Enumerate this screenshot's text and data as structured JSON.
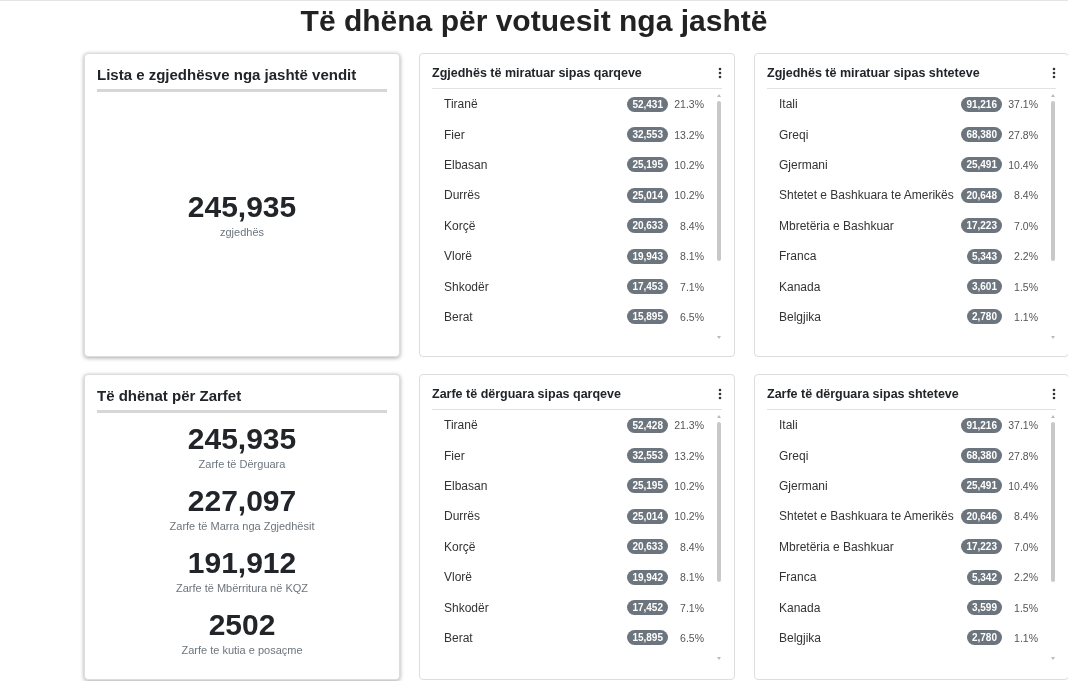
{
  "title": "Të dhëna për votuesit nga jashtë",
  "cards": [
    {
      "kind": "stat",
      "title": "Lista e zgjedhësve nga jashtë vendit",
      "stats": [
        {
          "value": "245,935",
          "label": "zgjedhës"
        }
      ]
    },
    {
      "kind": "list",
      "title": "Zgjedhës të miratuar sipas qarqeve",
      "rows": [
        {
          "name": "Tiranë",
          "count": "52,431",
          "percent": "21.3%"
        },
        {
          "name": "Fier",
          "count": "32,553",
          "percent": "13.2%"
        },
        {
          "name": "Elbasan",
          "count": "25,195",
          "percent": "10.2%"
        },
        {
          "name": "Durrës",
          "count": "25,014",
          "percent": "10.2%"
        },
        {
          "name": "Korçë",
          "count": "20,633",
          "percent": "8.4%"
        },
        {
          "name": "Vlorë",
          "count": "19,943",
          "percent": "8.1%"
        },
        {
          "name": "Shkodër",
          "count": "17,453",
          "percent": "7.1%"
        },
        {
          "name": "Berat",
          "count": "15,895",
          "percent": "6.5%"
        }
      ]
    },
    {
      "kind": "list",
      "title": "Zgjedhës të miratuar sipas shteteve",
      "rows": [
        {
          "name": "Itali",
          "count": "91,216",
          "percent": "37.1%"
        },
        {
          "name": "Greqi",
          "count": "68,380",
          "percent": "27.8%"
        },
        {
          "name": "Gjermani",
          "count": "25,491",
          "percent": "10.4%"
        },
        {
          "name": "Shtetet e Bashkuara te Amerikës",
          "count": "20,648",
          "percent": "8.4%"
        },
        {
          "name": "Mbretëria e Bashkuar",
          "count": "17,223",
          "percent": "7.0%"
        },
        {
          "name": "Franca",
          "count": "5,343",
          "percent": "2.2%"
        },
        {
          "name": "Kanada",
          "count": "3,601",
          "percent": "1.5%"
        },
        {
          "name": "Belgjika",
          "count": "2,780",
          "percent": "1.1%"
        }
      ]
    },
    {
      "kind": "stat",
      "title": "Të dhënat për Zarfet",
      "stats": [
        {
          "value": "245,935",
          "label": "Zarfe të Dërguara"
        },
        {
          "value": "227,097",
          "label": "Zarfe të Marra nga Zgjedhësit"
        },
        {
          "value": "191,912",
          "label": "Zarfe të Mbërritura në KQZ"
        },
        {
          "value": "2502",
          "label": "Zarfe te kutia e posaçme"
        }
      ]
    },
    {
      "kind": "list",
      "title": "Zarfe të dërguara sipas qarqeve",
      "rows": [
        {
          "name": "Tiranë",
          "count": "52,428",
          "percent": "21.3%"
        },
        {
          "name": "Fier",
          "count": "32,553",
          "percent": "13.2%"
        },
        {
          "name": "Elbasan",
          "count": "25,195",
          "percent": "10.2%"
        },
        {
          "name": "Durrës",
          "count": "25,014",
          "percent": "10.2%"
        },
        {
          "name": "Korçë",
          "count": "20,633",
          "percent": "8.4%"
        },
        {
          "name": "Vlorë",
          "count": "19,942",
          "percent": "8.1%"
        },
        {
          "name": "Shkodër",
          "count": "17,452",
          "percent": "7.1%"
        },
        {
          "name": "Berat",
          "count": "15,895",
          "percent": "6.5%"
        }
      ]
    },
    {
      "kind": "list",
      "title": "Zarfe të dërguara sipas shteteve",
      "rows": [
        {
          "name": "Itali",
          "count": "91,216",
          "percent": "37.1%"
        },
        {
          "name": "Greqi",
          "count": "68,380",
          "percent": "27.8%"
        },
        {
          "name": "Gjermani",
          "count": "25,491",
          "percent": "10.4%"
        },
        {
          "name": "Shtetet e Bashkuara te Amerikës",
          "count": "20,646",
          "percent": "8.4%"
        },
        {
          "name": "Mbretëria e Bashkuar",
          "count": "17,223",
          "percent": "7.0%"
        },
        {
          "name": "Franca",
          "count": "5,342",
          "percent": "2.2%"
        },
        {
          "name": "Kanada",
          "count": "3,599",
          "percent": "1.5%"
        },
        {
          "name": "Belgjika",
          "count": "2,780",
          "percent": "1.1%"
        }
      ]
    }
  ]
}
